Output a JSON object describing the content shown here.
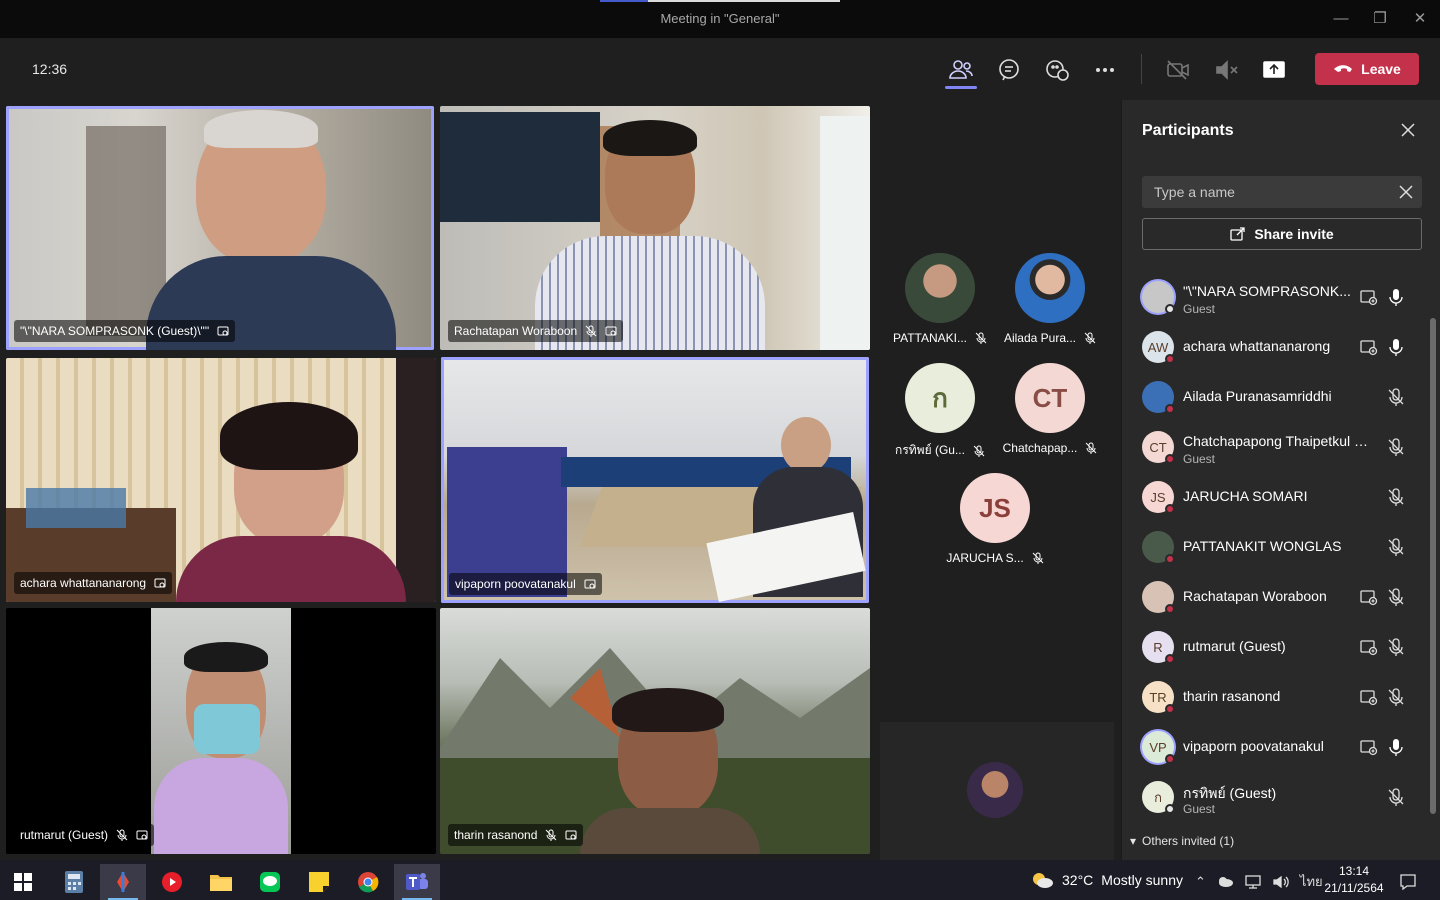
{
  "window": {
    "title": "Meeting in \"General\""
  },
  "toolbar": {
    "clock": "12:36",
    "leave_label": "Leave"
  },
  "tiles": [
    {
      "name": "\"\\\"NARA SOMPRASONK (Guest)\\\"\""
    },
    {
      "name": "Rachatapan Woraboon"
    },
    {
      "name": "achara whattananarong"
    },
    {
      "name": "vipaporn poovatanakul"
    },
    {
      "name": "rutmarut (Guest)"
    },
    {
      "name": "tharin rasanond"
    }
  ],
  "avatar_gallery": [
    {
      "name": "PATTANAKI...",
      "initials": ""
    },
    {
      "name": "Ailada Pura...",
      "initials": ""
    },
    {
      "name": "กรทิพย์ (Gu...",
      "initials": "ก",
      "color": "#e9eddc"
    },
    {
      "name": "Chatchapap...",
      "initials": "CT",
      "color": "#f3d8d3"
    },
    {
      "name": "JARUCHA S...",
      "initials": "JS",
      "color": "#f7d7d4"
    }
  ],
  "panel": {
    "title": "Participants",
    "search_placeholder": "Type a name",
    "share_label": "Share invite",
    "participants": [
      {
        "name": "\"\\\"NARA SOMPRASONK...",
        "role": "Guest",
        "initials": "",
        "color": "#c7c7c7",
        "video": true,
        "mic": "on"
      },
      {
        "name": "achara whattananarong",
        "role": "",
        "initials": "AW",
        "color": "#dbe4ea",
        "video": true,
        "mic": "on"
      },
      {
        "name": "Ailada Puranasamriddhi",
        "role": "",
        "initials": "",
        "color": "#3b6fb6",
        "video": false,
        "mic": "off"
      },
      {
        "name": "Chatchapapong Thaipetkul (G...",
        "role": "Guest",
        "initials": "CT",
        "color": "#f3d8d3",
        "video": false,
        "mic": "off"
      },
      {
        "name": "JARUCHA SOMARI",
        "role": "",
        "initials": "JS",
        "color": "#f7d7d4",
        "video": false,
        "mic": "off"
      },
      {
        "name": "PATTANAKIT WONGLAS",
        "role": "",
        "initials": "",
        "color": "#4a5a4a",
        "video": false,
        "mic": "off"
      },
      {
        "name": "Rachatapan Woraboon",
        "role": "",
        "initials": "",
        "color": "#d8c2b5",
        "video": true,
        "mic": "off"
      },
      {
        "name": "rutmarut (Guest)",
        "role": "",
        "initials": "R",
        "color": "#e5dff0",
        "video": true,
        "mic": "off"
      },
      {
        "name": "tharin rasanond",
        "role": "",
        "initials": "TR",
        "color": "#f6e1c6",
        "video": true,
        "mic": "off"
      },
      {
        "name": "vipaporn poovatanakul",
        "role": "",
        "initials": "VP",
        "color": "#dcebd7",
        "video": true,
        "mic": "on"
      },
      {
        "name": "กรทิพย์ (Guest)",
        "role": "Guest",
        "initials": "ก",
        "color": "#e9eddc",
        "video": false,
        "mic": "off"
      }
    ],
    "others_label": "Others invited (1)"
  },
  "taskbar": {
    "weather_temp": "32°C",
    "weather_desc": "Mostly sunny",
    "lang": "ไทย",
    "time": "13:14",
    "date": "21/11/2564"
  }
}
